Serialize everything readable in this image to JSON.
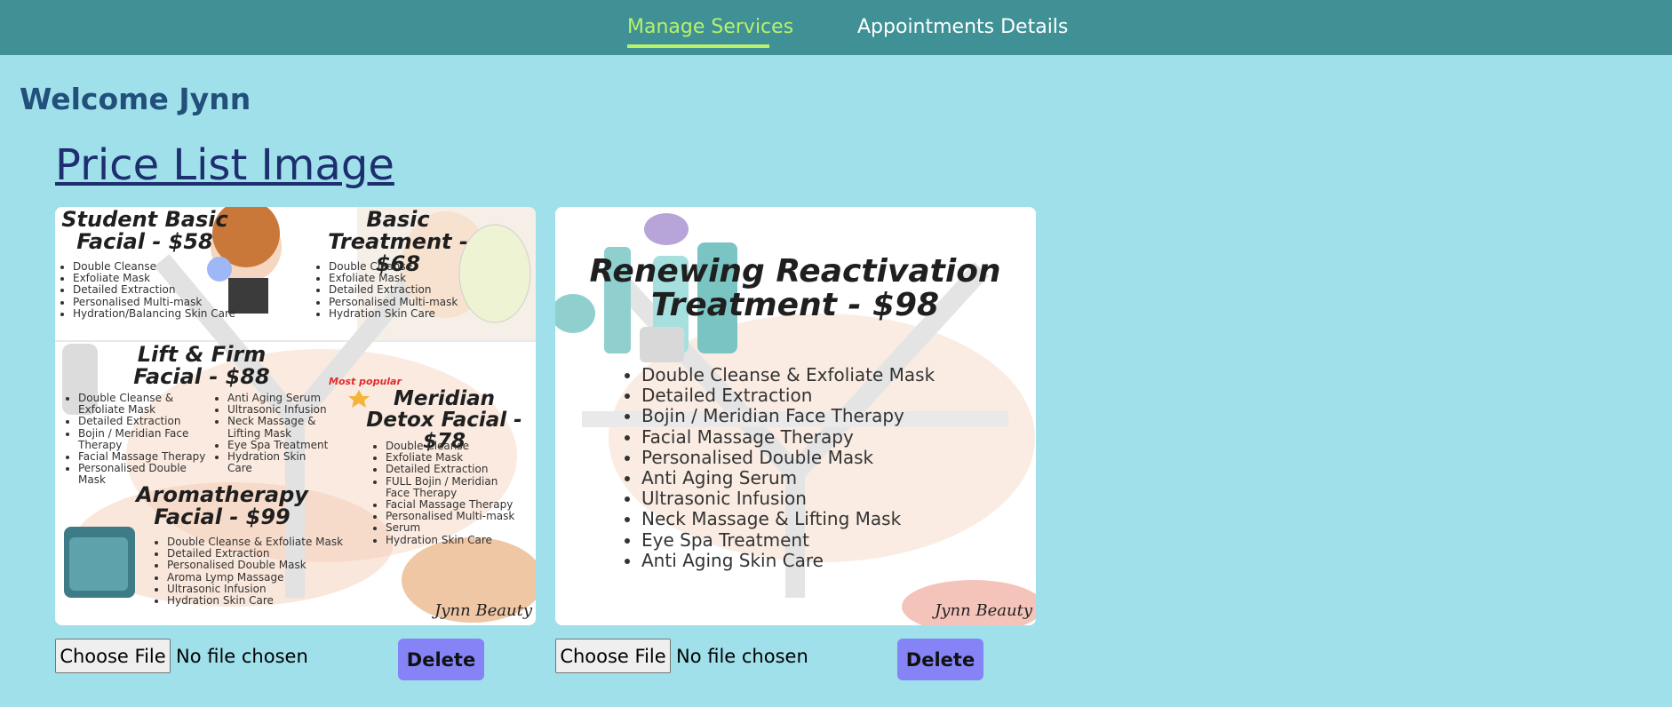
{
  "nav": {
    "items": [
      {
        "label": "Manage Services",
        "active": true
      },
      {
        "label": "Appointments Details",
        "active": false
      }
    ],
    "active_color": "#b9f16a",
    "bg_color": "#3f9196"
  },
  "welcome": "Welcome Jynn",
  "section_title": "Price List Image",
  "cards": [
    {
      "brand": "Jynn Beauty",
      "most_popular": "Most popular",
      "blocks": [
        {
          "title": "Student Basic Facial - $58",
          "items": [
            "Double Cleanse",
            "Exfoliate Mask",
            "Detailed Extraction",
            "Personalised Multi-mask",
            "Hydration/Balancing Skin Care"
          ]
        },
        {
          "title": "Basic Treatment - $68",
          "items": [
            "Double Cleanse",
            "Exfoliate Mask",
            "Detailed Extraction",
            "Personalised Multi-mask",
            "Hydration Skin Care"
          ]
        },
        {
          "title": "Lift & Firm Facial - $88",
          "items": [
            "Double Cleanse & Exfoliate Mask",
            "Detailed Extraction",
            "Bojin / Meridian Face Therapy",
            "Facial Massage Therapy",
            "Personalised Double Mask"
          ],
          "items2": [
            "Anti Aging Serum",
            "Ultrasonic Infusion",
            "Neck Massage & Lifting Mask",
            "Eye Spa Treatment",
            "Hydration Skin Care"
          ]
        },
        {
          "title": "Meridian Detox Facial - $78",
          "items": [
            "Double Cleanse",
            "Exfoliate Mask",
            "Detailed Extraction",
            "FULL Bojin / Meridian Face Therapy",
            "Facial Massage Therapy",
            "Personalised Multi-mask",
            "Serum",
            "Hydration Skin Care"
          ]
        },
        {
          "title": "Aromatherapy Facial - $99",
          "items": [
            "Double Cleanse & Exfoliate Mask",
            "Detailed Extraction",
            "Personalised Double Mask",
            "Aroma Lymp Massage",
            "Ultrasonic Infusion",
            "Hydration Skin Care"
          ]
        }
      ],
      "file_button": "Choose File",
      "file_status": "No file chosen",
      "delete_label": "Delete"
    },
    {
      "brand": "Jynn Beauty",
      "title": "Renewing Reactivation Treatment - $98",
      "items": [
        "Double Cleanse & Exfoliate Mask",
        "Detailed Extraction",
        "Bojin / Meridian Face Therapy",
        "Facial Massage Therapy",
        "Personalised Double Mask",
        "Anti Aging Serum",
        "Ultrasonic Infusion",
        "Neck Massage & Lifting Mask",
        "Eye Spa Treatment",
        "Anti Aging Skin Care"
      ],
      "file_button": "Choose File",
      "file_status": "No file chosen",
      "delete_label": "Delete"
    }
  ]
}
